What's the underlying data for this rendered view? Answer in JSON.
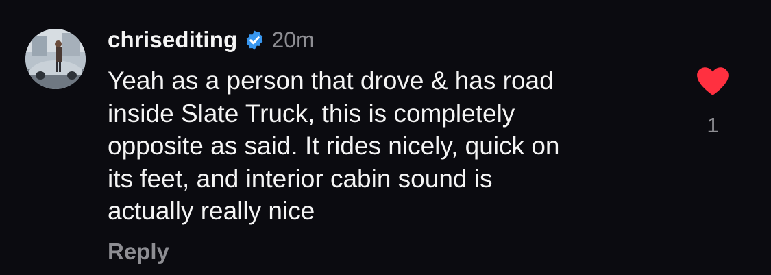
{
  "comment": {
    "username": "chrisediting",
    "verified_icon": "verified-badge-icon",
    "timestamp": "20m",
    "text": "Yeah as a person that drove & has road\ninside Slate Truck, this is completely\nopposite as said. It rides nicely, quick on\nits feet, and interior cabin sound is\nactually really nice",
    "reply_label": "Reply",
    "like_icon": "heart-icon",
    "like_count": "1"
  },
  "colors": {
    "background": "#0b0b10",
    "text": "#f5f5f5",
    "muted": "#8e8e93",
    "verified": "#3897f0",
    "heart": "#ff3040"
  }
}
